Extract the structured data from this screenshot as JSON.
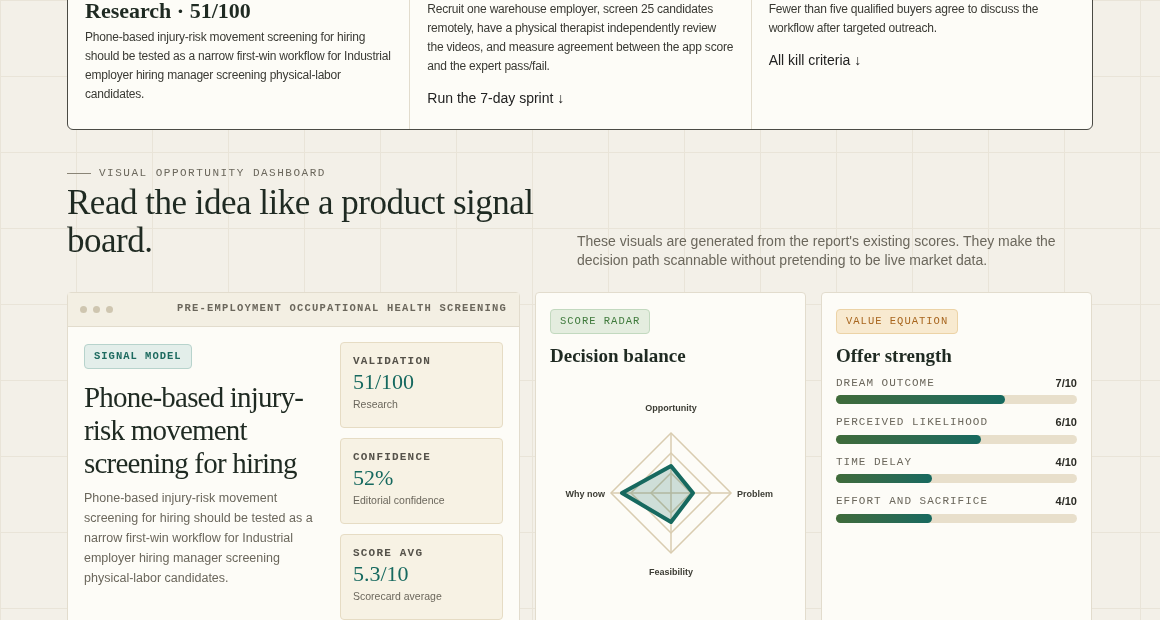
{
  "summary_card": {
    "columns": [
      {
        "title": "Research · 51/100",
        "body": "Phone-based injury-risk movement screening for hiring should be tested as a narrow first-win workflow for Industrial employer hiring manager screening physical-labor candidates."
      },
      {
        "body": "Recruit one warehouse employer, screen 25 candidates remotely, have a physical therapist independently review the videos, and measure agreement between the app score and the expert pass/fail.",
        "link": "Run the 7-day sprint ↓"
      },
      {
        "body": "Fewer than five qualified buyers agree to discuss the workflow after targeted outreach.",
        "link": "All kill criteria ↓"
      }
    ]
  },
  "dashboard": {
    "eyebrow": "VISUAL OPPORTUNITY DASHBOARD",
    "heading": "Read the idea like a product signal board.",
    "intro": "These visuals are generated from the report's existing scores. They make the decision path scannable without pretending to be live market data."
  },
  "signal_card": {
    "window_title": "PRE-EMPLOYMENT OCCUPATIONAL HEALTH SCREENING",
    "tag": "SIGNAL MODEL",
    "title": "Phone-based injury-risk movement screening for hiring",
    "body": "Phone-based injury-risk movement screening for hiring should be tested as a narrow first-win workflow for Industrial employer hiring manager screening physical-labor candidates.",
    "stats": [
      {
        "label": "VALIDATION",
        "value": "51/100",
        "caption": "Research"
      },
      {
        "label": "CONFIDENCE",
        "value": "52%",
        "caption": "Editorial confidence"
      },
      {
        "label": "SCORE AVG",
        "value": "5.3/10",
        "caption": "Scorecard average"
      }
    ]
  },
  "radar_card": {
    "tag": "SCORE RADAR",
    "title": "Decision balance",
    "axes": [
      "Opportunity",
      "Problem",
      "Feasibility",
      "Why now"
    ]
  },
  "offer_card": {
    "tag": "VALUE EQUATION",
    "title": "Offer strength",
    "bars": [
      {
        "label": "DREAM OUTCOME",
        "value": "7/10",
        "level": 0.7
      },
      {
        "label": "PERCEIVED LIKELIHOOD",
        "value": "6/10",
        "level": 0.6
      },
      {
        "label": "TIME DELAY",
        "value": "4/10",
        "level": 0.4
      },
      {
        "label": "EFFORT AND SACRIFICE",
        "value": "4/10",
        "level": 0.4
      }
    ]
  }
}
